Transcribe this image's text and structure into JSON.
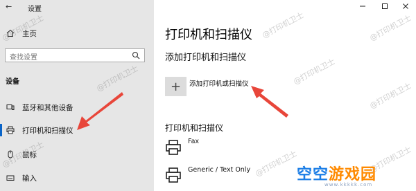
{
  "window": {
    "title": "设置"
  },
  "sidebar": {
    "home": "主页",
    "search_placeholder": "查找设置",
    "section": "设备",
    "items": [
      {
        "label": "蓝牙和其他设备",
        "icon": "bluetooth-devices-icon"
      },
      {
        "label": "打印机和扫描仪",
        "icon": "printer-icon",
        "selected": true
      },
      {
        "label": "鼠标",
        "icon": "mouse-icon"
      },
      {
        "label": "输入",
        "icon": "keyboard-icon"
      }
    ]
  },
  "main": {
    "title": "打印机和扫描仪",
    "add_heading": "添加打印机和扫描仪",
    "add_label": "添加打印机或扫描仪",
    "list_heading": "打印机和扫描仪",
    "printers": [
      "Fax",
      "Generic / Text Only"
    ]
  },
  "watermark_text": "@打印机卫士",
  "logo": {
    "part1": "空空",
    "part2": "游戏园",
    "url": "www.kkkkk.com"
  },
  "colors": {
    "accent": "#0a64c8",
    "arrow": "#e8463a",
    "sidebar_bg": "#e6e6e6"
  }
}
